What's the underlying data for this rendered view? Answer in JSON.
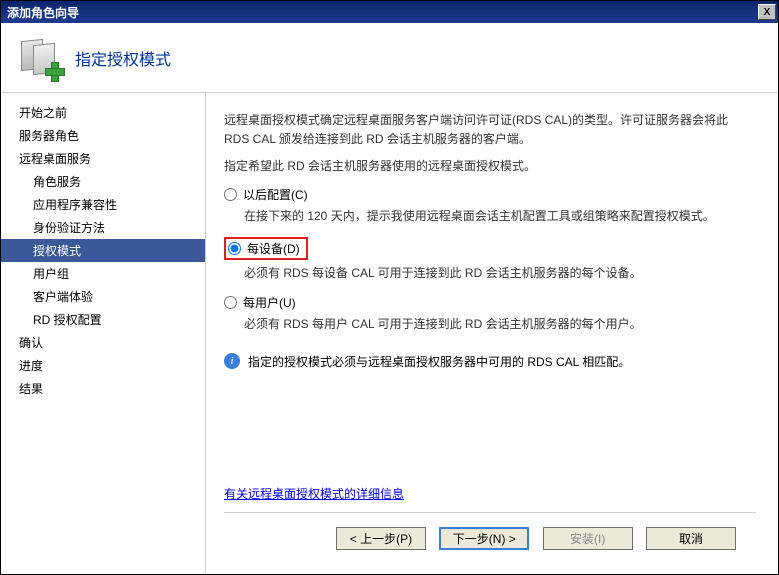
{
  "titlebar": {
    "title": "添加角色向导",
    "close": "X"
  },
  "header": {
    "title": "指定授权模式"
  },
  "sidebar": {
    "items": [
      {
        "label": "开始之前",
        "indent": false
      },
      {
        "label": "服务器角色",
        "indent": false
      },
      {
        "label": "远程桌面服务",
        "indent": false
      },
      {
        "label": "角色服务",
        "indent": true
      },
      {
        "label": "应用程序兼容性",
        "indent": true
      },
      {
        "label": "身份验证方法",
        "indent": true
      },
      {
        "label": "授权模式",
        "indent": true,
        "selected": true
      },
      {
        "label": "用户组",
        "indent": true
      },
      {
        "label": "客户端体验",
        "indent": true
      },
      {
        "label": "RD 授权配置",
        "indent": true
      },
      {
        "label": "确认",
        "indent": false
      },
      {
        "label": "进度",
        "indent": false
      },
      {
        "label": "结果",
        "indent": false
      }
    ]
  },
  "content": {
    "description": "远程桌面授权模式确定远程桌面服务客户端访问许可证(RDS CAL)的类型。许可证服务器会将此 RDS CAL 颁发给连接到此 RD 会话主机服务器的客户端。",
    "prompt": "指定希望此 RD 会话主机服务器使用的远程桌面授权模式。",
    "options": [
      {
        "key": "later",
        "label": "以后配置(C)",
        "help": "在接下来的 120 天内，提示我使用远程桌面会话主机配置工具或组策略来配置授权模式。",
        "checked": false,
        "highlight": false
      },
      {
        "key": "per-device",
        "label": "每设备(D)",
        "help": "必须有 RDS 每设备 CAL 可用于连接到此 RD 会话主机服务器的每个设备。",
        "checked": true,
        "highlight": true
      },
      {
        "key": "per-user",
        "label": "每用户(U)",
        "help": "必须有 RDS 每用户 CAL 可用于连接到此 RD 会话主机服务器的每个用户。",
        "checked": false,
        "highlight": false
      }
    ],
    "info": "指定的授权模式必须与远程桌面授权服务器中可用的 RDS CAL 相匹配。",
    "link": "有关远程桌面授权模式的详细信息"
  },
  "footer": {
    "prev": "< 上一步(P)",
    "next": "下一步(N) >",
    "install": "安装(I)",
    "cancel": "取消"
  }
}
